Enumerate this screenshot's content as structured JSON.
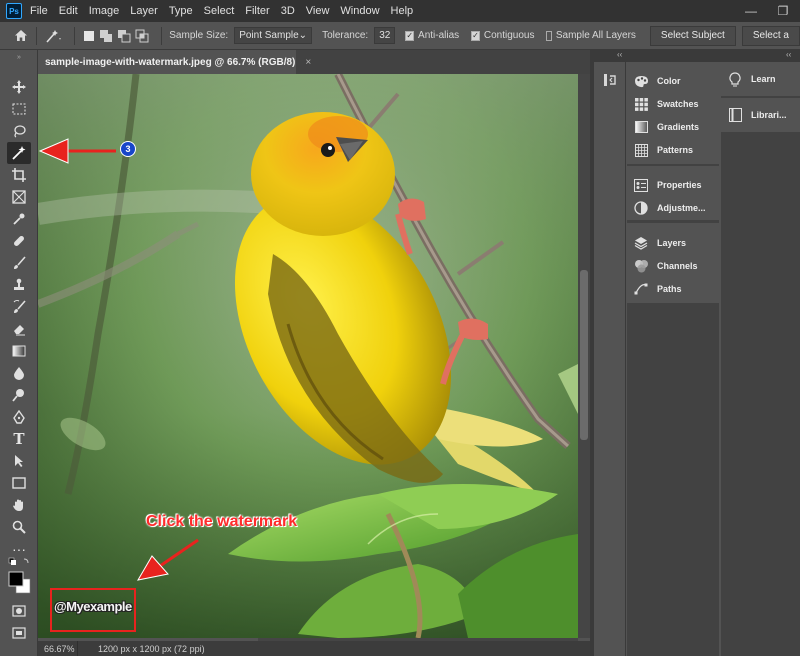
{
  "app": {
    "logo": "Ps"
  },
  "menu": [
    "File",
    "Edit",
    "Image",
    "Layer",
    "Type",
    "Select",
    "Filter",
    "3D",
    "View",
    "Window",
    "Help"
  ],
  "window_controls": {
    "minimize": "—",
    "restore": "❐"
  },
  "options_bar": {
    "sample_size_label": "Sample Size:",
    "sample_size_value": "Point Sample",
    "tolerance_label": "Tolerance:",
    "tolerance_value": "32",
    "anti_alias_label": "Anti-alias",
    "anti_alias_checked": true,
    "contiguous_label": "Contiguous",
    "contiguous_checked": true,
    "sample_all_layers_label": "Sample All Layers",
    "sample_all_layers_checked": false,
    "select_subject_label": "Select Subject",
    "select_a_label": "Select a"
  },
  "document": {
    "tab_title": "sample-image-with-watermark.jpeg @ 66.7% (RGB/8)",
    "close_glyph": "×",
    "zoom": "66.67%",
    "dimensions": "1200 px x 1200 px (72 ppi)"
  },
  "panels": {
    "collapse_glyph": "‹‹",
    "column1": [
      "Color",
      "Swatches",
      "Gradients",
      "Patterns",
      "Properties",
      "Adjustme...",
      "Layers",
      "Channels",
      "Paths"
    ],
    "column2": [
      "Learn",
      "Librari..."
    ]
  },
  "annotations": {
    "badge": "3",
    "instruction": "Click the watermark",
    "watermark_text": "@Myexample",
    "color": "#e8231e"
  },
  "colors": {
    "menubar": "#323232",
    "workspace": "#535353",
    "panel_dark": "#424242",
    "accent": "#31a8ff"
  }
}
